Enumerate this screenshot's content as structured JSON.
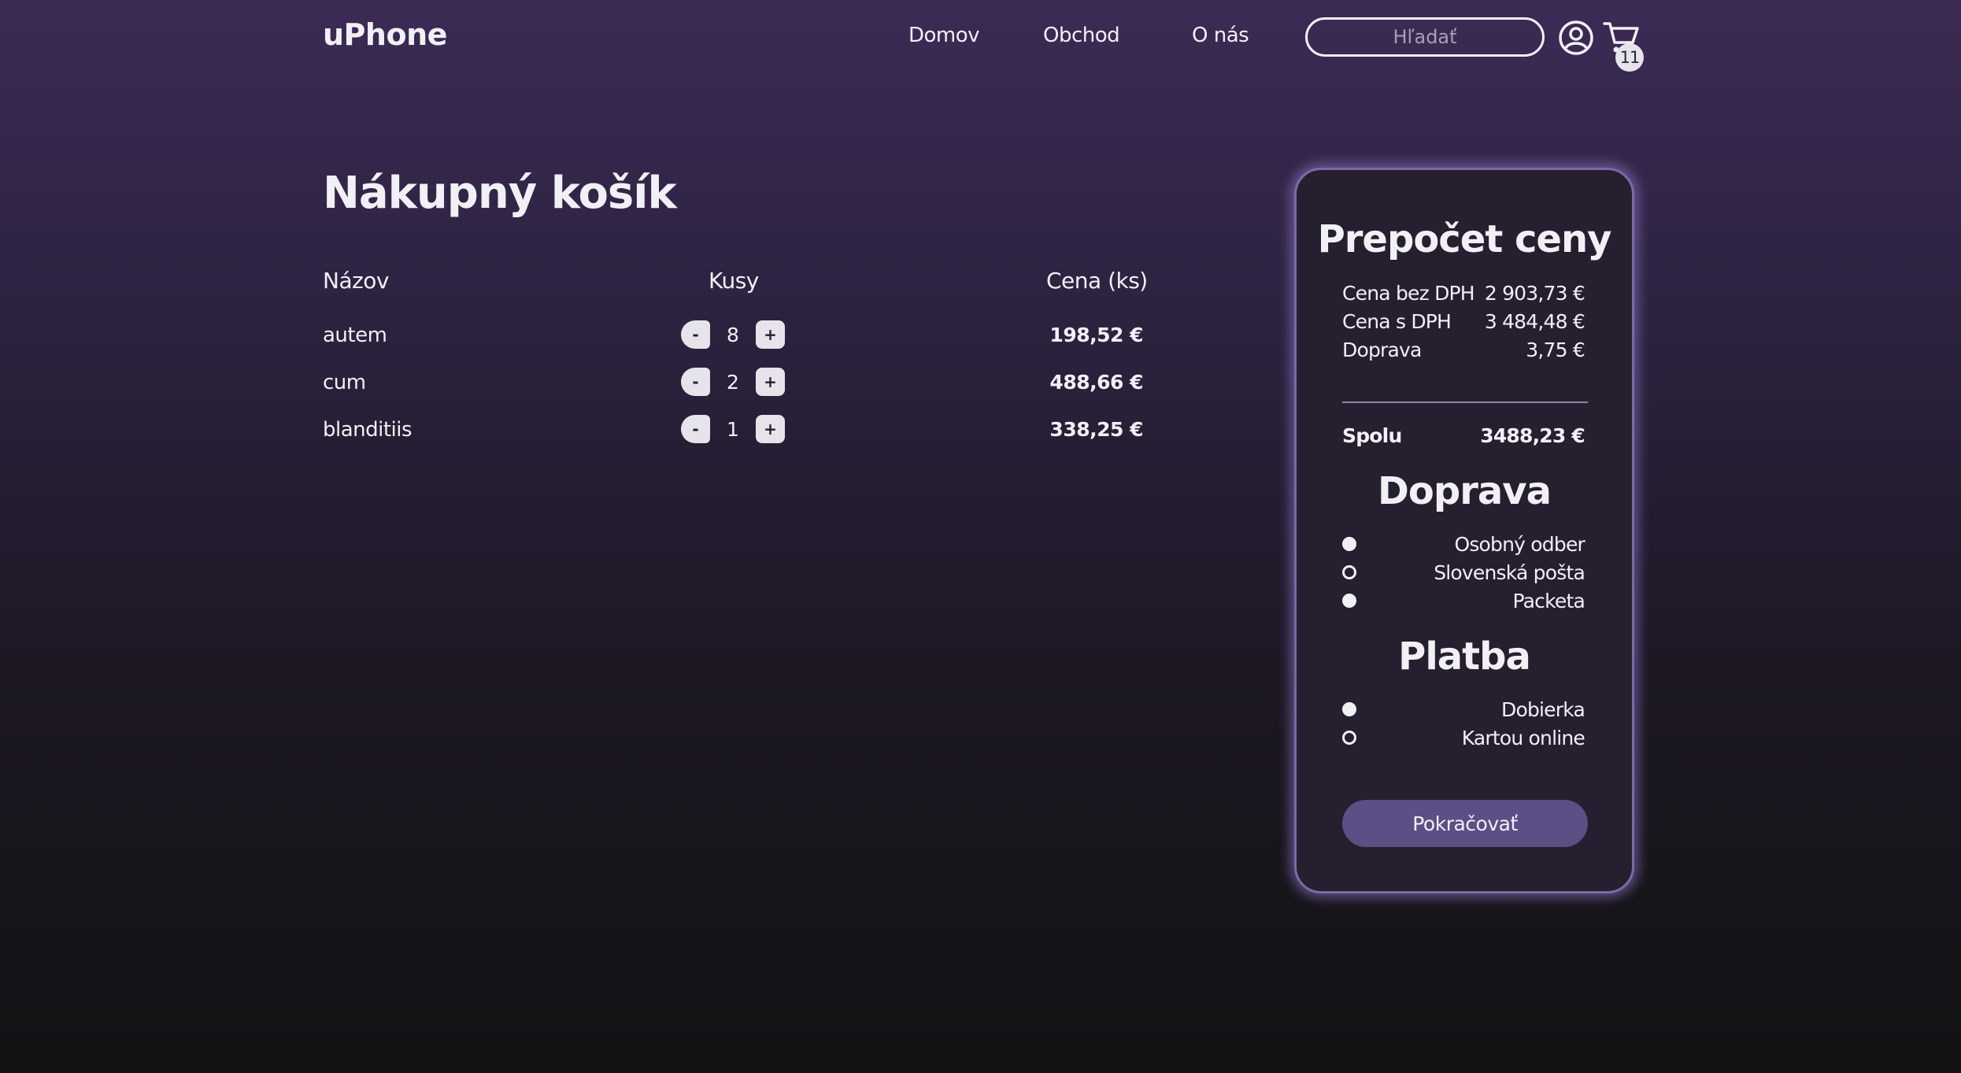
{
  "header": {
    "logo": "uPhone",
    "nav": [
      {
        "label": "Domov"
      },
      {
        "label": "Obchod"
      },
      {
        "label": "O nás"
      }
    ],
    "search_placeholder": "Hľadať",
    "cart_count": "11"
  },
  "cart": {
    "title": "Nákupný košík",
    "columns": {
      "name": "Názov",
      "qty": "Kusy",
      "price": "Cena (ks)"
    },
    "items": [
      {
        "name": "autem",
        "qty": "8",
        "price": "198,52 €",
        "minus": "-",
        "plus": "+"
      },
      {
        "name": "cum",
        "qty": "2",
        "price": "488,66 €",
        "minus": "-",
        "plus": "+"
      },
      {
        "name": "blanditiis",
        "qty": "1",
        "price": "338,25 €",
        "minus": "-",
        "plus": "+"
      }
    ]
  },
  "summary": {
    "title": "Prepočet ceny",
    "lines": [
      {
        "label": "Cena bez DPH",
        "value": "2 903,73 €"
      },
      {
        "label": "Cena s DPH",
        "value": "3 484,48 €"
      },
      {
        "label": "Doprava",
        "value": "3,75 €"
      }
    ],
    "total_label": "Spolu",
    "total_value": "3488,23 €",
    "shipping_title": "Doprava",
    "shipping_options": [
      {
        "label": "Osobný odber",
        "checked": true
      },
      {
        "label": "Slovenská pošta",
        "checked": false
      },
      {
        "label": "Packeta",
        "checked": true
      }
    ],
    "payment_title": "Platba",
    "payment_options": [
      {
        "label": "Dobierka",
        "checked": true
      },
      {
        "label": "Kartou online",
        "checked": false
      }
    ],
    "continue_label": "Pokračovať"
  },
  "colors": {
    "accent": "#5d4e86",
    "panel_border": "#7a6aa8",
    "background_top": "#3c2b55",
    "background_bottom": "#131214"
  },
  "icons": {
    "user": "user-circle-icon",
    "cart": "shopping-cart-icon"
  }
}
